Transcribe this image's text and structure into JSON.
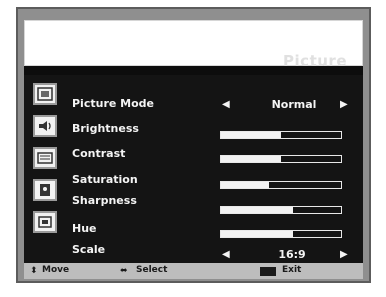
{
  "menu": {
    "title": "Picture",
    "rows": [
      {
        "label": "Picture Mode",
        "icon": "picture-mode-icon",
        "type": "select",
        "value": "Normal"
      },
      {
        "label": "Brightness",
        "icon": "brightness-icon",
        "type": "slider",
        "level_percent": 50
      },
      {
        "label": "Contrast",
        "icon": "contrast-icon",
        "type": "slider",
        "level_percent": 50
      },
      {
        "label": "Saturation",
        "icon": "saturation-icon",
        "type": "slider",
        "level_percent": 40
      },
      {
        "label": "Sharpness",
        "icon": "sharpness-icon",
        "type": "slider",
        "level_percent": 60
      },
      {
        "label": "Hue",
        "icon": "hue-icon",
        "type": "slider",
        "level_percent": 60
      },
      {
        "label": "Scale",
        "icon": "scale-icon",
        "type": "select",
        "value": "16:9"
      }
    ]
  },
  "footer": {
    "move_label": "Move",
    "select_label": "Select",
    "exit_label": "Exit"
  },
  "colors": {
    "frame": "#8f8f8f",
    "panel": "#141414",
    "footer": "#bdbdbd",
    "text": "#f4f4f4"
  }
}
